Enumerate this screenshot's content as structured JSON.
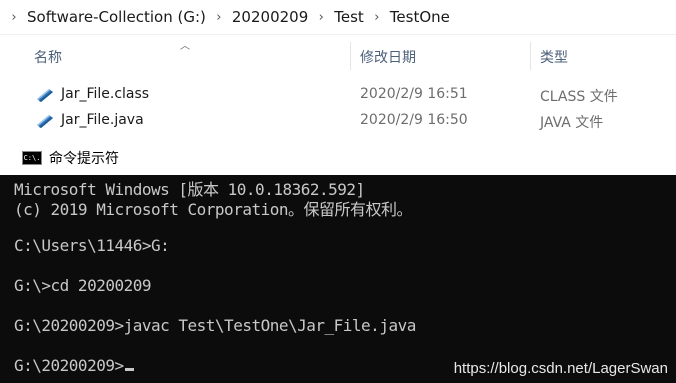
{
  "explorer": {
    "breadcrumb": [
      "Software-Collection (G:)",
      "20200209",
      "Test",
      "TestOne"
    ],
    "columns": {
      "name": "名称",
      "modified": "修改日期",
      "type": "类型"
    },
    "files": [
      {
        "name": "Jar_File.class",
        "modified": "2020/2/9 16:51",
        "type": "CLASS 文件",
        "icon": "java-file-icon"
      },
      {
        "name": "Jar_File.java",
        "modified": "2020/2/9 16:50",
        "type": "JAVA 文件",
        "icon": "java-file-icon"
      }
    ]
  },
  "console": {
    "title": "命令提示符",
    "icon_text": "C:\\.",
    "lines": [
      "Microsoft Windows [版本 10.0.18362.592]",
      "(c) 2019 Microsoft Corporation。保留所有权利。",
      "",
      "C:\\Users\\11446>G:",
      "",
      "G:\\>cd 20200209",
      "",
      "G:\\20200209>javac Test\\TestOne\\Jar_File.java",
      "",
      "G:\\20200209>"
    ],
    "watermark": "https://blog.csdn.net/LagerSwan"
  },
  "colors": {
    "console_bg": "#0c0c0c",
    "console_text": "#c8c8c8",
    "header_text": "#4c607a"
  }
}
